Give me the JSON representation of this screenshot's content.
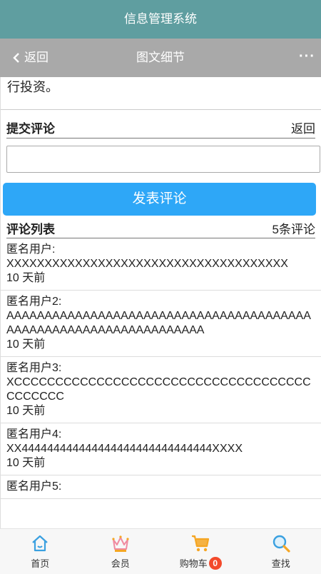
{
  "app": {
    "title": "信息管理系统"
  },
  "nav": {
    "back_label": "返回",
    "title": "图文细节",
    "more_label": "···"
  },
  "article": {
    "tail_text": "购方面，魔方先后对寓趣等国内多个知名的公寓项目进行投资。"
  },
  "submit_section": {
    "title": "提交评论",
    "back_label": "返回",
    "input_value": "",
    "button_label": "发表评论"
  },
  "comments_section": {
    "title": "评论列表",
    "count_label": "5条评论",
    "items": [
      {
        "user": "匿名用户:",
        "text": "XXXXXXXXXXXXXXXXXXXXXXXXXXXXXXXXXXXXX",
        "time": "10 天前"
      },
      {
        "user": "匿名用户2:",
        "text": "AAAAAAAAAAAAAAAAAAAAAAAAAAAAAAAAAAAAAAAAAAAAAAAAAAAAAAAAAAAAAAAAAA",
        "time": "10 天前"
      },
      {
        "user": "匿名用户3:",
        "text": "XCCCCCCCCCCCCCCCCCCCCCCCCCCCCCCCCCCCCCCCCCCC",
        "time": "10 天前"
      },
      {
        "user": "匿名用户4:",
        "text": "XX444444444444444444444444444444XXXX",
        "time": "10 天前"
      },
      {
        "user": "匿名用户5:",
        "text": "",
        "time": ""
      }
    ]
  },
  "tabbar": {
    "items": [
      {
        "label": "首页",
        "icon": "home-icon"
      },
      {
        "label": "会员",
        "icon": "crown-icon"
      },
      {
        "label": "购物车",
        "icon": "cart-icon",
        "badge": "0"
      },
      {
        "label": "查找",
        "icon": "search-icon"
      }
    ]
  },
  "colors": {
    "topbar": "#5f9ea0",
    "navbar": "#a9a9a9",
    "button": "#2ea7f7",
    "badge": "#f34a2b",
    "icon_blue": "#3aa0e0",
    "icon_pink": "#f08aa0",
    "icon_orange": "#f5a623"
  }
}
